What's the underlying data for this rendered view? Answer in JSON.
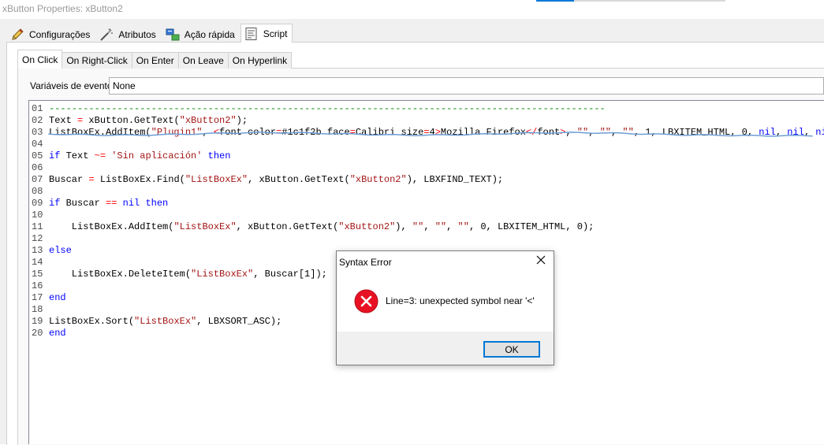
{
  "window": {
    "title": "xButton Properties: xButton2"
  },
  "main_tabs": [
    {
      "label": "Configurações",
      "icon": "pencil-icon"
    },
    {
      "label": "Atributos",
      "icon": "wand-icon"
    },
    {
      "label": "Ação rápida",
      "icon": "quick-action-icon"
    },
    {
      "label": "Script",
      "icon": "script-icon",
      "active": true
    }
  ],
  "sub_tabs": [
    {
      "label": "On Click",
      "active": true
    },
    {
      "label": "On Right-Click"
    },
    {
      "label": "On Enter"
    },
    {
      "label": "On Leave"
    },
    {
      "label": "On Hyperlink"
    }
  ],
  "event": {
    "label": "Variáveis de evento:",
    "value": "None"
  },
  "code_lines": [
    {
      "n": "01",
      "tokens": [
        [
          "cm",
          "--------------------------------------------------------------------------------------------------"
        ]
      ]
    },
    {
      "n": "02",
      "tokens": [
        [
          "plain",
          "Text "
        ],
        [
          "op",
          "="
        ],
        [
          "plain",
          " xButton.GetText("
        ],
        [
          "str",
          "\"xButton2\""
        ],
        [
          "plain",
          ");"
        ]
      ]
    },
    {
      "n": "03",
      "tokens": [
        [
          "plain",
          "ListBoxEx.AddItem("
        ],
        [
          "str",
          "\"Plugin1\""
        ],
        [
          "plain",
          ", "
        ],
        [
          "op",
          "<"
        ],
        [
          "plain",
          "font color"
        ],
        [
          "op",
          "="
        ],
        [
          "plain",
          "#1c1f2b face"
        ],
        [
          "op",
          "="
        ],
        [
          "plain",
          "Calibri size"
        ],
        [
          "op",
          "="
        ],
        [
          "plain",
          "4"
        ],
        [
          "op",
          ">"
        ],
        [
          "plain",
          "Mozilla Firefox"
        ],
        [
          "op",
          "</"
        ],
        [
          "plain",
          "font"
        ],
        [
          "op",
          ">"
        ],
        [
          "plain",
          ", "
        ],
        [
          "str",
          "\"\""
        ],
        [
          "plain",
          ", "
        ],
        [
          "str",
          "\"\""
        ],
        [
          "plain",
          ", "
        ],
        [
          "str",
          "\"\""
        ],
        [
          "plain",
          ", 1, LBXITEM_HTML, 0, "
        ],
        [
          "kw",
          "nil"
        ],
        [
          "plain",
          ", "
        ],
        [
          "kw",
          "nil"
        ],
        [
          "plain",
          ", "
        ],
        [
          "kw",
          "nil"
        ],
        [
          "plain",
          ");"
        ]
      ]
    },
    {
      "n": "04",
      "tokens": []
    },
    {
      "n": "05",
      "tokens": [
        [
          "kw",
          "if"
        ],
        [
          "plain",
          " Text "
        ],
        [
          "op",
          "~="
        ],
        [
          "plain",
          " "
        ],
        [
          "str",
          "'Sin aplicación'"
        ],
        [
          "plain",
          " "
        ],
        [
          "kw",
          "then"
        ]
      ]
    },
    {
      "n": "06",
      "tokens": []
    },
    {
      "n": "07",
      "tokens": [
        [
          "plain",
          "Buscar "
        ],
        [
          "op",
          "="
        ],
        [
          "plain",
          " ListBoxEx.Find("
        ],
        [
          "str",
          "\"ListBoxEx\""
        ],
        [
          "plain",
          ", xButton.GetText("
        ],
        [
          "str",
          "\"xButton2\""
        ],
        [
          "plain",
          "), LBXFIND_TEXT);"
        ]
      ]
    },
    {
      "n": "08",
      "tokens": []
    },
    {
      "n": "09",
      "tokens": [
        [
          "kw",
          "if"
        ],
        [
          "plain",
          " Buscar "
        ],
        [
          "op",
          "=="
        ],
        [
          "plain",
          " "
        ],
        [
          "kw",
          "nil"
        ],
        [
          "plain",
          " "
        ],
        [
          "kw",
          "then"
        ]
      ]
    },
    {
      "n": "10",
      "tokens": []
    },
    {
      "n": "11",
      "tokens": [
        [
          "plain",
          "    ListBoxEx.AddItem("
        ],
        [
          "str",
          "\"ListBoxEx\""
        ],
        [
          "plain",
          ", xButton.GetText("
        ],
        [
          "str",
          "\"xButton2\""
        ],
        [
          "plain",
          "), "
        ],
        [
          "str",
          "\"\""
        ],
        [
          "plain",
          ", "
        ],
        [
          "str",
          "\"\""
        ],
        [
          "plain",
          ", "
        ],
        [
          "str",
          "\"\""
        ],
        [
          "plain",
          ", 0, LBXITEM_HTML, 0);"
        ]
      ]
    },
    {
      "n": "12",
      "tokens": []
    },
    {
      "n": "13",
      "tokens": [
        [
          "kw",
          "else"
        ]
      ]
    },
    {
      "n": "14",
      "tokens": []
    },
    {
      "n": "15",
      "tokens": [
        [
          "plain",
          "    ListBoxEx.DeleteItem("
        ],
        [
          "str",
          "\"ListBoxEx\""
        ],
        [
          "plain",
          ", Buscar[1]);"
        ]
      ]
    },
    {
      "n": "16",
      "tokens": []
    },
    {
      "n": "17",
      "tokens": [
        [
          "kw",
          "end"
        ]
      ]
    },
    {
      "n": "18",
      "tokens": []
    },
    {
      "n": "19",
      "tokens": [
        [
          "plain",
          "ListBoxEx.Sort("
        ],
        [
          "str",
          "\"ListBoxEx\""
        ],
        [
          "plain",
          ", LBXSORT_ASC);"
        ]
      ]
    },
    {
      "n": "20",
      "tokens": [
        [
          "kw",
          "end"
        ]
      ]
    }
  ],
  "dialog": {
    "title": "Syntax Error",
    "message": "Line=3: unexpected symbol near '<'",
    "ok_label": "OK",
    "icon": "error-icon"
  },
  "colors": {
    "keyword": "#0000ff",
    "string": "#a31515",
    "comment": "#008000",
    "operator": "#ff0000",
    "error": "#e81123",
    "squiggle": "#6d9ed6"
  }
}
